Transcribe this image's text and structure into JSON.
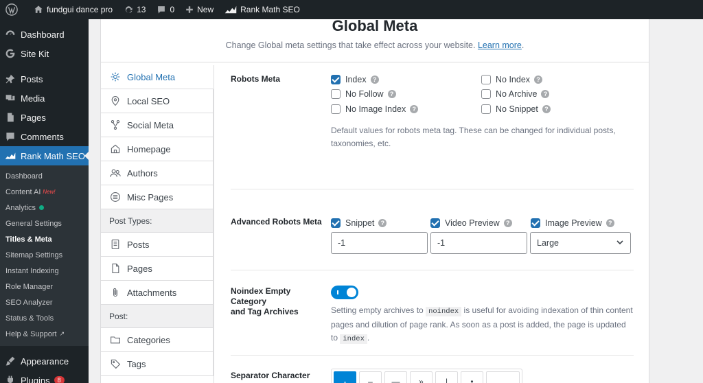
{
  "adminbar": {
    "site_name": "fundgui dance pro",
    "updates_count": "13",
    "comments_count": "0",
    "new_label": "New",
    "plugin_label": "Rank Math SEO"
  },
  "sidebar": {
    "items": [
      {
        "label": "Dashboard",
        "icon": "dashboard-icon"
      },
      {
        "label": "Site Kit",
        "icon": "google-g-icon"
      },
      {
        "label": "Posts",
        "icon": "pin-icon"
      },
      {
        "label": "Media",
        "icon": "media-icon"
      },
      {
        "label": "Pages",
        "icon": "page-icon"
      },
      {
        "label": "Comments",
        "icon": "comment-icon"
      },
      {
        "label": "Rank Math SEO",
        "icon": "rankmath-icon"
      }
    ],
    "submenu": [
      "Dashboard",
      "Content AI",
      "Analytics",
      "General Settings",
      "Titles & Meta",
      "Sitemap Settings",
      "Instant Indexing",
      "Role Manager",
      "SEO Analyzer",
      "Status & Tools",
      "Help & Support"
    ],
    "new_tag": "New!",
    "after": [
      {
        "label": "Appearance",
        "icon": "brush-icon"
      },
      {
        "label": "Plugins",
        "icon": "plugin-icon",
        "badge": "8"
      }
    ]
  },
  "header": {
    "title": "Global Meta",
    "description": "Change Global meta settings that take effect across your website.",
    "learn_more": "Learn more",
    "period": "."
  },
  "tabs": {
    "items": [
      {
        "label": "Global Meta",
        "icon": "gear-icon"
      },
      {
        "label": "Local SEO",
        "icon": "location-pin-icon"
      },
      {
        "label": "Social Meta",
        "icon": "share-icon"
      },
      {
        "label": "Homepage",
        "icon": "home-icon"
      },
      {
        "label": "Authors",
        "icon": "users-icon"
      },
      {
        "label": "Misc Pages",
        "icon": "list-circle-icon"
      }
    ],
    "group_post_types": "Post Types:",
    "post_types": [
      {
        "label": "Posts",
        "icon": "document-icon"
      },
      {
        "label": "Pages",
        "icon": "pages-icon"
      },
      {
        "label": "Attachments",
        "icon": "paperclip-icon"
      }
    ],
    "group_post": "Post:",
    "taxonomies": [
      {
        "label": "Categories",
        "icon": "folder-icon"
      },
      {
        "label": "Tags",
        "icon": "tag-icon"
      }
    ]
  },
  "robots_meta": {
    "label": "Robots Meta",
    "options": [
      {
        "label": "Index",
        "checked": true
      },
      {
        "label": "No Index",
        "checked": false
      },
      {
        "label": "No Follow",
        "checked": false
      },
      {
        "label": "No Archive",
        "checked": false
      },
      {
        "label": "No Image Index",
        "checked": false
      },
      {
        "label": "No Snippet",
        "checked": false
      }
    ],
    "hint_line1": "Default values for robots meta tag. These can be changed for individual posts,",
    "hint_line2": "taxonomies, etc."
  },
  "advanced_robots": {
    "label": "Advanced Robots Meta",
    "snippet_label": "Snippet",
    "snippet_value": "-1",
    "video_label": "Video Preview",
    "video_value": "-1",
    "image_label": "Image Preview",
    "image_value": "Large"
  },
  "noindex_empty": {
    "label_line1": "Noindex Empty Category",
    "label_line2": "and Tag Archives",
    "enabled": true,
    "hint_a": "Setting empty archives to",
    "code_a": "noindex",
    "hint_b": "is useful for avoiding indexation of thin content",
    "hint_c": "pages and dilution of page rank. As soon as a post is added, the page is updated to",
    "code_b": "index",
    "hint_d": "."
  },
  "separator": {
    "label": "Separator Character",
    "options": [
      "-",
      "–",
      "—",
      "»",
      "|",
      "•",
      ""
    ],
    "selected": "-"
  },
  "colors": {
    "accent": "#2271b1",
    "toggle": "#0084d6",
    "admin_dark": "#1d2327"
  }
}
